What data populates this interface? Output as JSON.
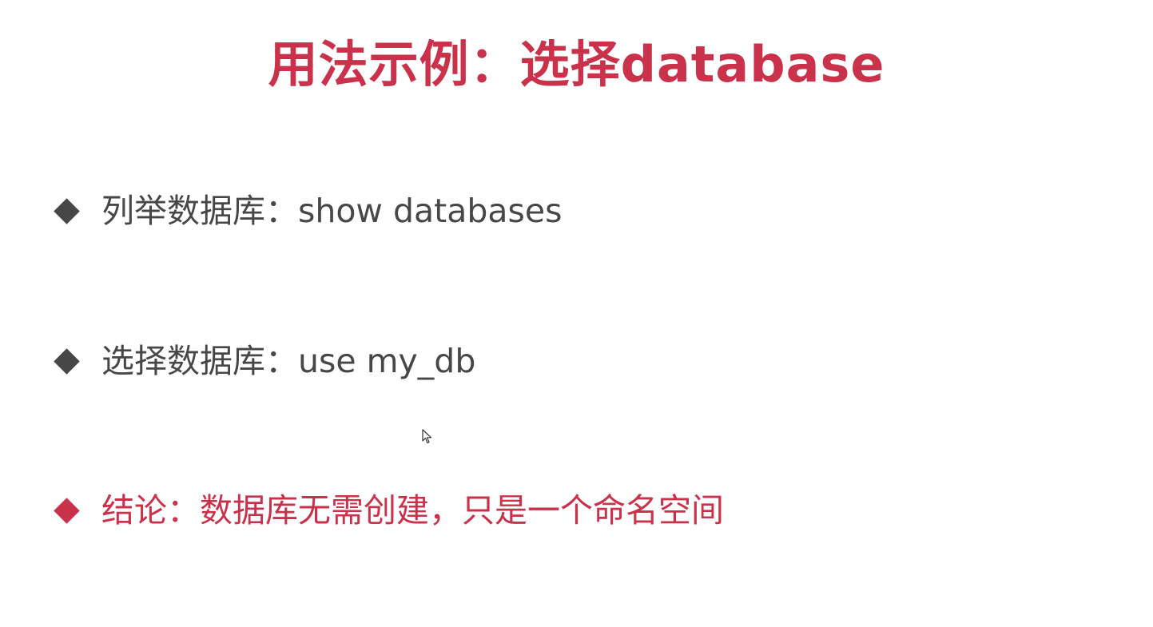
{
  "slide": {
    "title": "用法示例：选择database",
    "bullets": [
      {
        "text": "列举数据库：show databases",
        "color": "#474747"
      },
      {
        "text": "选择数据库：use my_db",
        "color": "#474747"
      },
      {
        "text": "结论：数据库无需创建，只是一个命名空间",
        "color": "#c9324a"
      }
    ]
  },
  "theme": {
    "accent": "#c9324a",
    "text": "#474747",
    "background": "#ffffff"
  },
  "icons": {
    "bullet": "diamond-bullet-icon",
    "cursor": "mouse-cursor-icon"
  }
}
